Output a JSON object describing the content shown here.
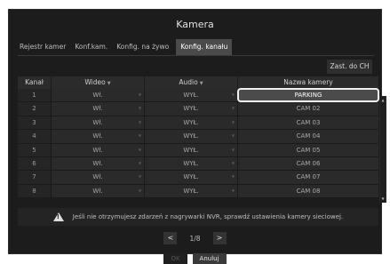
{
  "window": {
    "title": "Kamera"
  },
  "tabs": [
    {
      "label": "Rejestr kamer",
      "active": false
    },
    {
      "label": "Konf.kam.",
      "active": false
    },
    {
      "label": "Konfig. na żywo",
      "active": false
    },
    {
      "label": "Konfig. kanału",
      "active": true
    }
  ],
  "toolbar": {
    "zast_label": "Zast. do CH"
  },
  "table": {
    "headers": {
      "channel": "Kanał",
      "video": "Wideo",
      "audio": "Audio",
      "name": "Nazwa kamery"
    },
    "rows": [
      {
        "ch": "1",
        "video": "Wł.",
        "audio": "WYŁ.",
        "name": "PARKING",
        "selected": true
      },
      {
        "ch": "2",
        "video": "Wł.",
        "audio": "WYŁ.",
        "name": "CAM 02"
      },
      {
        "ch": "3",
        "video": "Wł.",
        "audio": "WYŁ.",
        "name": "CAM 03"
      },
      {
        "ch": "4",
        "video": "Wł.",
        "audio": "WYŁ.",
        "name": "CAM 04"
      },
      {
        "ch": "5",
        "video": "Wł.",
        "audio": "WYŁ.",
        "name": "CAM 05"
      },
      {
        "ch": "6",
        "video": "Wł.",
        "audio": "WYŁ.",
        "name": "CAM 06"
      },
      {
        "ch": "7",
        "video": "Wł.",
        "audio": "WYŁ.",
        "name": "CAM 07"
      },
      {
        "ch": "8",
        "video": "Wł.",
        "audio": "WYŁ.",
        "name": "CAM 08"
      }
    ]
  },
  "warning": {
    "icon": "warning-icon",
    "text": "Jeśli nie otrzymujesz zdarzeń z nagrywarki NVR, sprawdź ustawienia kamery sieciowej."
  },
  "pager": {
    "prev": "<",
    "next": ">",
    "page_text": "1/8"
  },
  "footer": {
    "ok_label": "OK",
    "cancel_label": "Anuluj"
  },
  "colors": {
    "background": "#1c1c1c",
    "selected_outline": "#f0f0f0"
  }
}
